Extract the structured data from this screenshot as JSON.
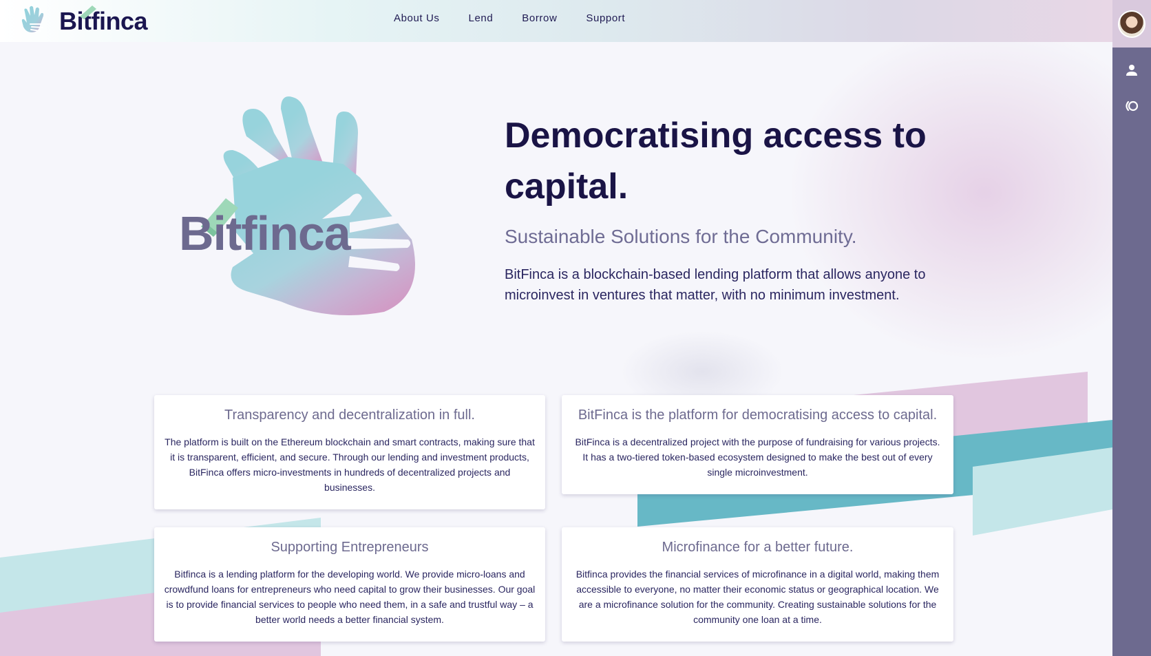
{
  "header": {
    "brand": "Bitfinca",
    "nav": [
      "About Us",
      "Lend",
      "Borrow",
      "Support"
    ]
  },
  "rail": {
    "icons": [
      "avatar",
      "user-icon",
      "logout-icon"
    ]
  },
  "hero": {
    "logo_text": "Bitfinca",
    "title": "Democratising access to capital.",
    "subtitle": "Sustainable Solutions for the Community.",
    "description": "BitFinca is a blockchain-based lending platform that allows anyone to microinvest in ventures that matter, with no minimum investment."
  },
  "cards": [
    {
      "title": "Transparency and decentralization in full.",
      "body": "The platform is built on the Ethereum blockchain and smart contracts, making sure that it is transparent, efficient, and secure. Through our lending and investment products, BitFinca offers micro-investments in hundreds of decentralized projects and businesses."
    },
    {
      "title": "BitFinca is the platform for democratising access to capital.",
      "body": "BitFinca is a decentralized project with the purpose of fundraising for various projects. It has a two-tiered token-based ecosystem designed to make the best out of every single microinvestment."
    },
    {
      "title": "Supporting Entrepreneurs",
      "body": "Bitfinca is a lending platform for the developing world. We provide micro-loans and crowdfund loans for entrepreneurs who need capital to grow their businesses. Our goal is to provide financial services to people who need them, in a safe and trustful way – a better world needs a better financial system."
    },
    {
      "title": "Microfinance for a better future.",
      "body": "Bitfinca provides the financial services of microfinance in a digital world, making them accessible to everyone, no matter their economic status or geographical location. We are a microfinance solution for the community. Creating sustainable solutions for the community one loan at a time."
    }
  ],
  "colors": {
    "navy": "#1a1446",
    "muted": "#6d6a8f",
    "teal": "#67b8c6",
    "light_teal": "#bfe3e6",
    "pink": "#e1c6df",
    "mint": "#9ed8b8"
  }
}
